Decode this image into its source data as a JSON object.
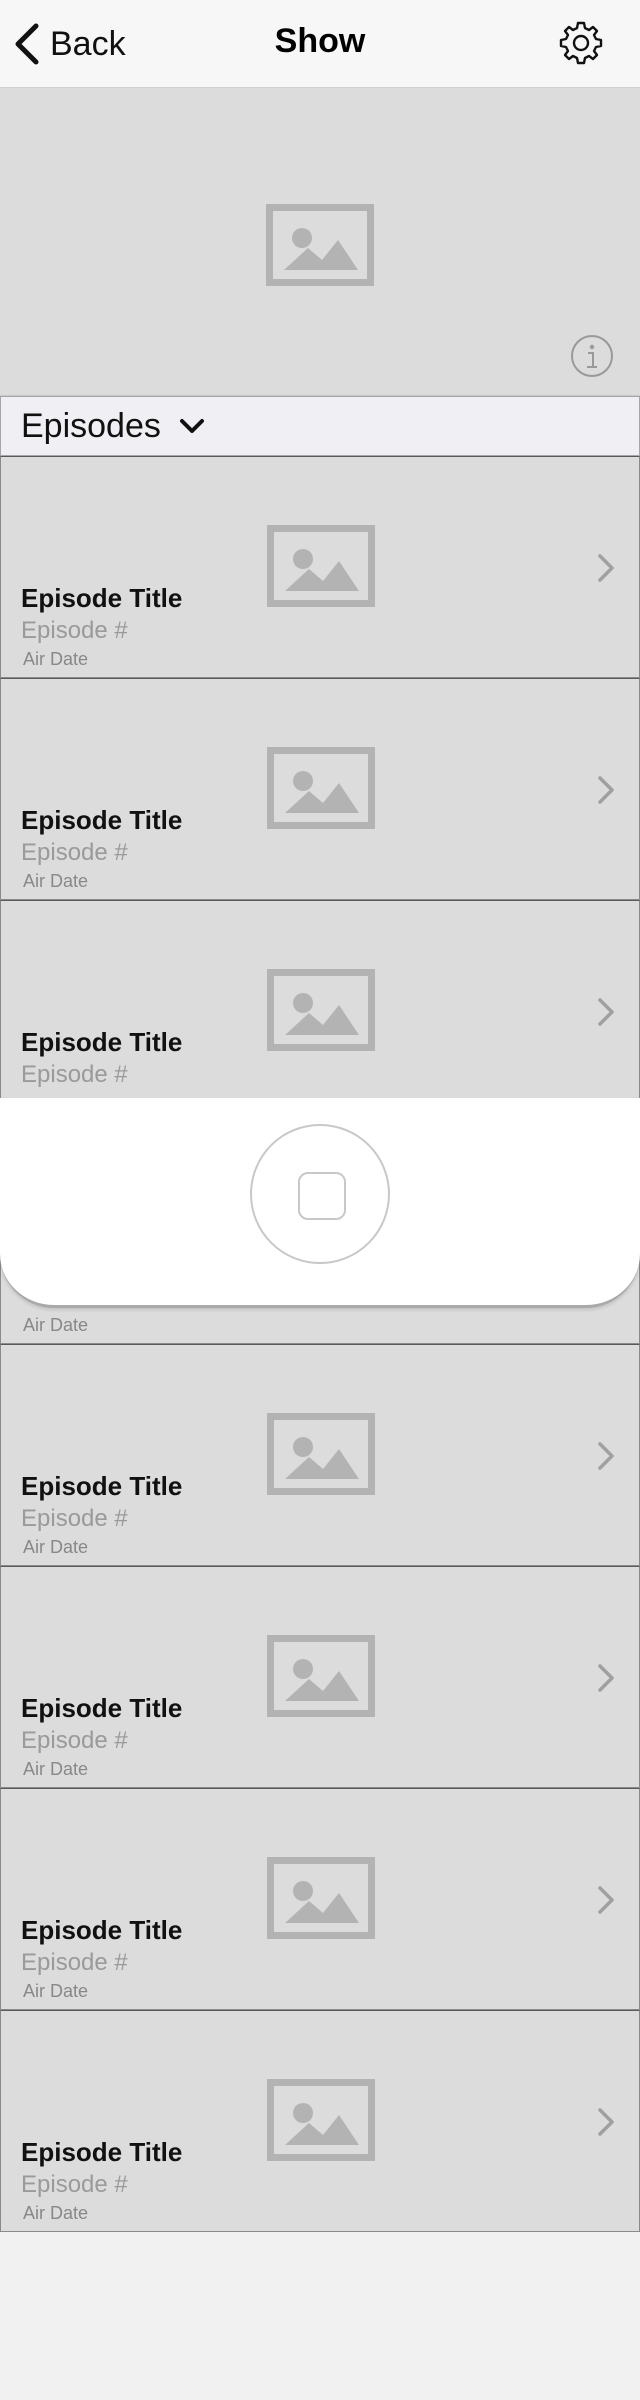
{
  "nav": {
    "back_label": "Back",
    "title": "Show",
    "settings_icon": "gear-icon"
  },
  "hero": {
    "image_icon": "image-placeholder-icon",
    "info_icon": "info-icon"
  },
  "section": {
    "label": "Episodes",
    "dropdown_icon": "chevron-down-icon"
  },
  "episodes": [
    {
      "title": "Episode Title",
      "number": "Episode #",
      "air_date": "Air Date"
    },
    {
      "title": "Episode Title",
      "number": "Episode #",
      "air_date": "Air Date"
    },
    {
      "title": "Episode Title",
      "number": "Episode #",
      "air_date": ""
    },
    {
      "title": "",
      "number": "",
      "air_date": "Air Date"
    },
    {
      "title": "Episode Title",
      "number": "Episode #",
      "air_date": "Air Date"
    },
    {
      "title": "Episode Title",
      "number": "Episode #",
      "air_date": "Air Date"
    },
    {
      "title": "Episode Title",
      "number": "Episode #",
      "air_date": "Air Date"
    },
    {
      "title": "Episode Title",
      "number": "Episode #",
      "air_date": "Air Date"
    }
  ],
  "overlay": {
    "home_button_icon": "home-button-icon"
  },
  "colors": {
    "row_background": "#dcdcdc",
    "placeholder_gray": "#b3b3b3",
    "page_background": "#f1f1f1"
  }
}
